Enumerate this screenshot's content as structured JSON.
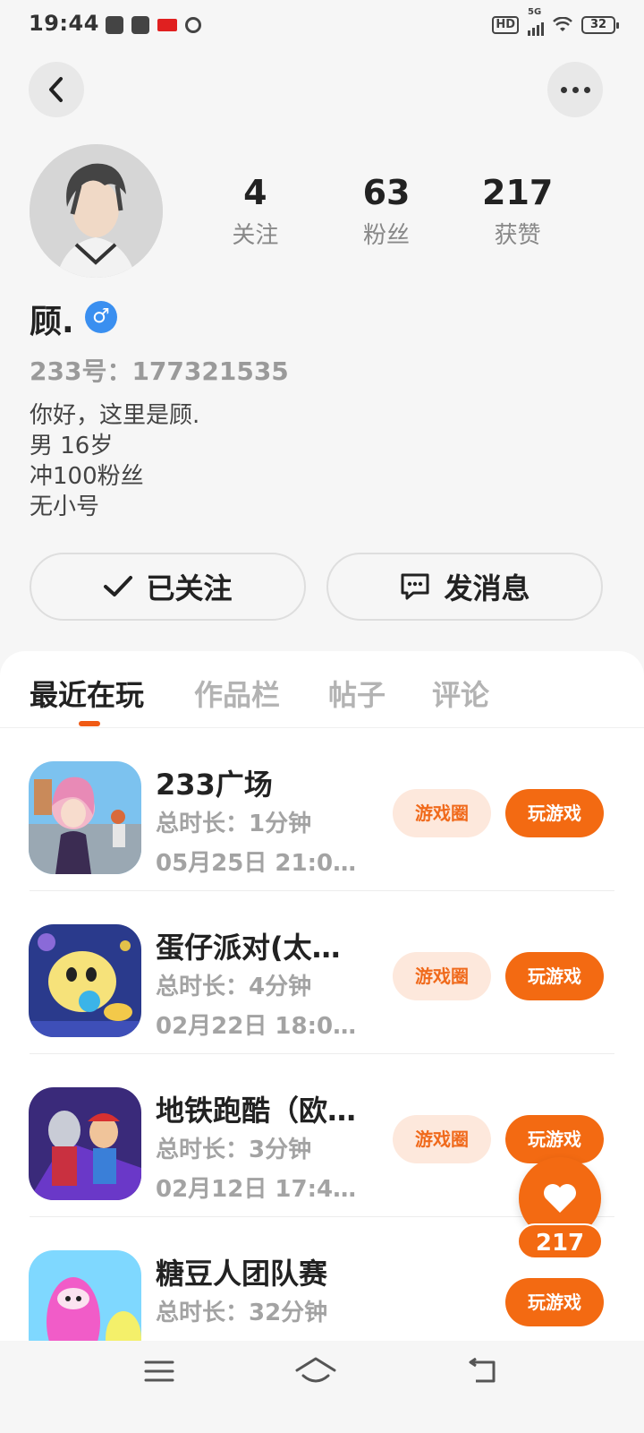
{
  "status_bar": {
    "time": "19:44",
    "network": "5G",
    "hd": "HD",
    "battery": "32"
  },
  "profile": {
    "name": "顾.",
    "gender_symbol": "♂",
    "id_text": "233号：177321535",
    "bio": [
      "你好，这里是顾.",
      "男 16岁",
      "冲100粉丝",
      "无小号"
    ],
    "stats": [
      {
        "value": "4",
        "label": "关注"
      },
      {
        "value": "63",
        "label": "粉丝"
      },
      {
        "value": "217",
        "label": "获赞"
      }
    ]
  },
  "actions": {
    "follow_label": "已关注",
    "message_label": "发消息"
  },
  "tabs": [
    {
      "label": "最近在玩",
      "active": true
    },
    {
      "label": "作品栏",
      "active": false
    },
    {
      "label": "帖子",
      "active": false
    },
    {
      "label": "评论",
      "active": false
    }
  ],
  "games": [
    {
      "title": "233广场",
      "duration": "总时长：1分钟",
      "time": "05月25日 21:0…",
      "circle_label": "游戏圈",
      "play_label": "玩游戏"
    },
    {
      "title": "蛋仔派对(太…",
      "duration": "总时长：4分钟",
      "time": "02月22日 18:0…",
      "circle_label": "游戏圈",
      "play_label": "玩游戏"
    },
    {
      "title": "地铁跑酷（欧…",
      "duration": "总时长：3分钟",
      "time": "02月12日 17:4…",
      "circle_label": "游戏圈",
      "play_label": "玩游戏"
    },
    {
      "title": "糖豆人团队赛",
      "duration": "总时长：32分钟",
      "time": "",
      "circle_label": "",
      "play_label": "玩游戏"
    }
  ],
  "like_float": {
    "count": "217"
  },
  "icons": {
    "back": "chevron-left-icon",
    "more": "more-dots-icon",
    "follow": "check-icon",
    "message": "chat-bubble-icon",
    "like": "heart-icon"
  },
  "colors": {
    "accent": "#f36a12",
    "accent_light": "#fde8dc",
    "gender_badge": "#3a8ff0"
  }
}
